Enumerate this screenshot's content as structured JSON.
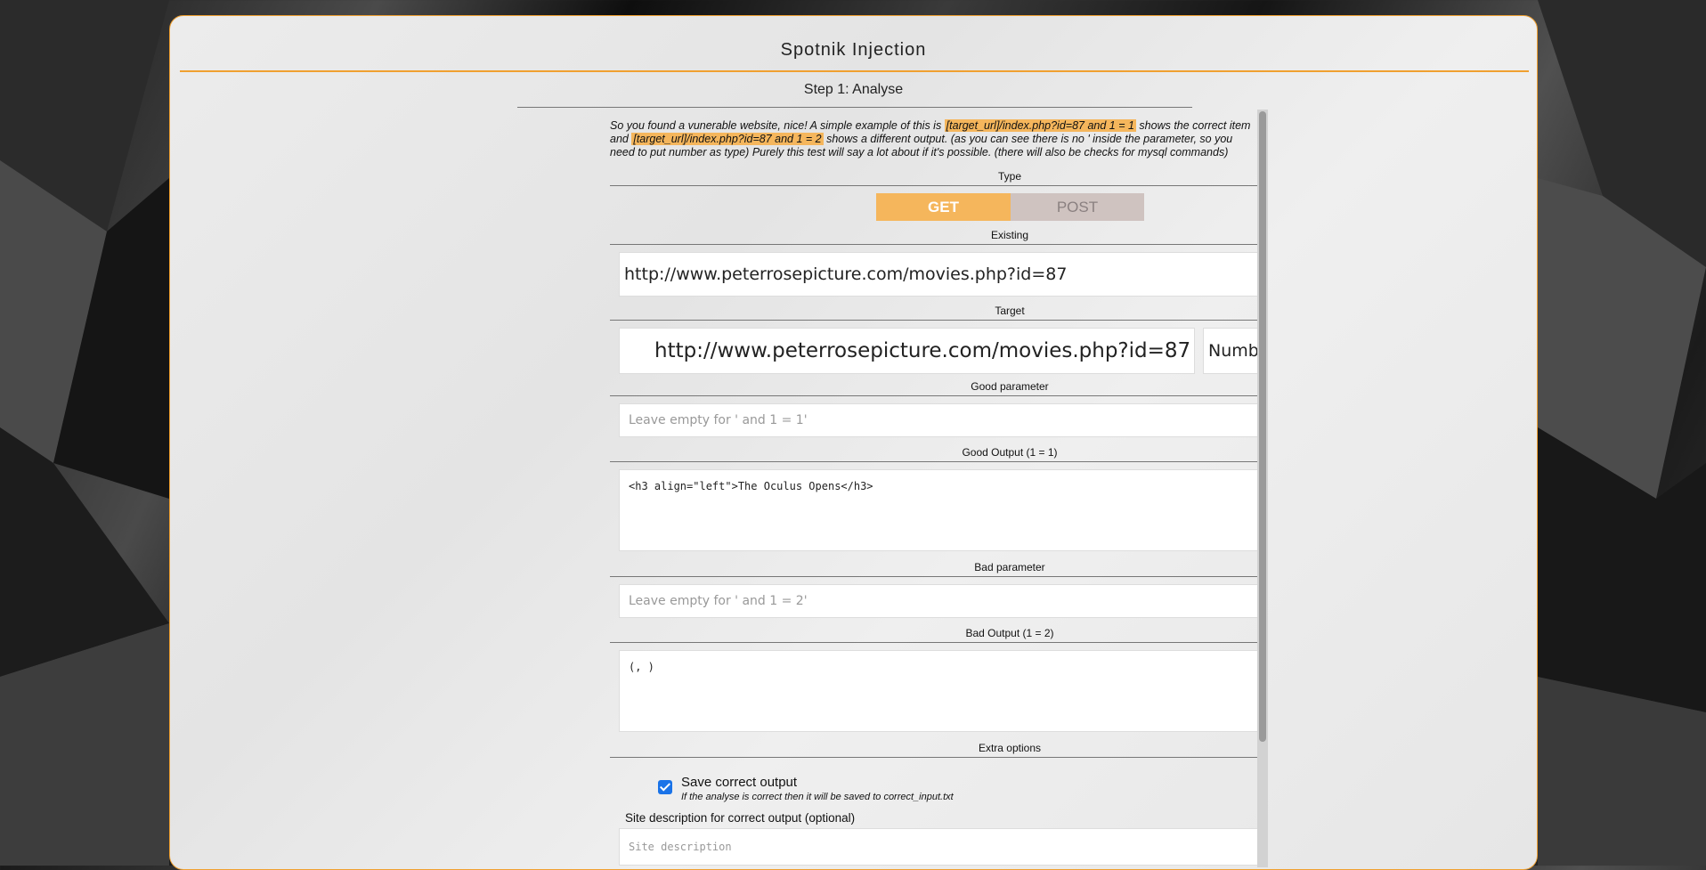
{
  "app": {
    "title": "Spotnik Injection"
  },
  "step": {
    "title": "Step 1: Analyse"
  },
  "intro": {
    "part1": "So you found a vunerable website, nice! A simple example of this is ",
    "example_good": "[target_url]/index.php?id=87 and 1 = 1",
    "part2": " shows the correct item and ",
    "example_bad": "[target_url]/index.php?id=87 and 1 = 2",
    "part3": " shows a different output. (as you can see there is no ' inside the parameter, so you need to put number as type) Purely this test will say a lot about if it's possible. (there will also be checks for mysql commands)"
  },
  "help_label": "?",
  "sections": {
    "type": "Type",
    "existing": "Existing",
    "target": "Target",
    "good_parameter": "Good parameter",
    "good_output": "Good Output (1 = 1)",
    "bad_parameter": "Bad parameter",
    "bad_output": "Bad Output (1 = 2)",
    "extra_options": "Extra options"
  },
  "type_toggle": {
    "get": "GET",
    "post": "POST",
    "selected": "GET"
  },
  "existing_select": {
    "value": "http://www.peterrosepicture.com/movies.php?id=87"
  },
  "target": {
    "url_value": "http://www.peterrosepicture.com/movies.php?id=87",
    "type_value": "Number"
  },
  "good_parameter": {
    "placeholder": "Leave empty for ' and 1 = 1'"
  },
  "good_output": {
    "value": "<h3 align=\"left\">The Oculus Opens</h3>"
  },
  "bad_parameter": {
    "placeholder": "Leave empty for ' and 1 = 2'"
  },
  "bad_output": {
    "value": "(, )"
  },
  "extra": {
    "save_label": "Save correct output",
    "save_checked": true,
    "save_hint": "If the analyse is correct then it will be saved to correct_input.txt",
    "desc_label": "Site description for correct output (optional)",
    "desc_placeholder": "Site description"
  },
  "colors": {
    "accent": "#f0a030",
    "toggle_active": "#f5b65c",
    "toggle_inactive": "#cfc3c0",
    "help_badge": "#f5a000"
  }
}
